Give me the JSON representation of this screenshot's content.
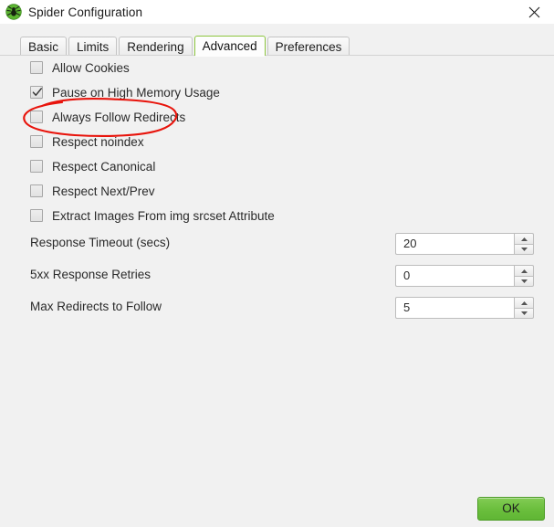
{
  "window": {
    "title": "Spider Configuration",
    "app_icon": "spider-logo-icon",
    "close_label": "✕",
    "background_color": "#f1f1f1",
    "titlebar_color": "#ffffff"
  },
  "tabs": {
    "selected": "Advanced",
    "accent_color": "#8dc63f",
    "items": [
      {
        "label": "Basic",
        "selected": false
      },
      {
        "label": "Limits",
        "selected": false
      },
      {
        "label": "Rendering",
        "selected": false
      },
      {
        "label": "Advanced",
        "selected": true
      },
      {
        "label": "Preferences",
        "selected": false
      }
    ]
  },
  "advanced_panel": {
    "checkboxes": [
      {
        "label": "Allow Cookies",
        "checked": false
      },
      {
        "label": "Pause on High Memory Usage",
        "checked": true
      },
      {
        "label": "Always Follow Redirects",
        "checked": false
      },
      {
        "label": "Respect noindex",
        "checked": false
      },
      {
        "label": "Respect Canonical",
        "checked": false
      },
      {
        "label": "Respect Next/Prev",
        "checked": false
      },
      {
        "label": "Extract Images From img srcset Attribute",
        "checked": false
      }
    ],
    "spinners": [
      {
        "label": "Response Timeout (secs)",
        "value": "20"
      },
      {
        "label": "5xx Response Retries",
        "value": "0"
      },
      {
        "label": "Max Redirects to Follow",
        "value": "5"
      }
    ]
  },
  "annotation": {
    "shape": "hand-drawn-ellipse",
    "color": "#e8140c",
    "target": "Always Follow Redirects"
  },
  "footer": {
    "ok_label": "OK",
    "ok_color": "#6cbf3e"
  }
}
